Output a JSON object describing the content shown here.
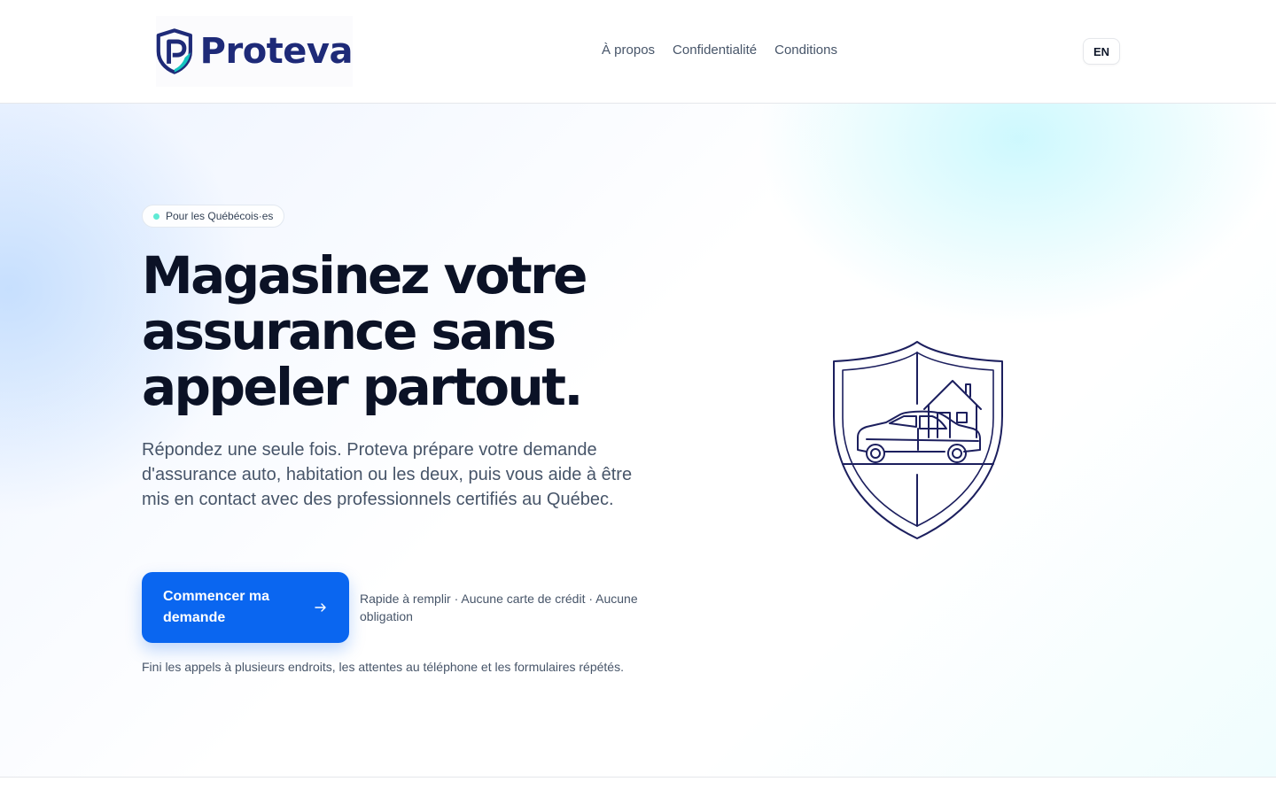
{
  "brand": {
    "name": "Proteva",
    "logo_icon": "shield-p-logo-icon",
    "colors": {
      "navy": "#1e2a78",
      "teal": "#14c5c0",
      "accent": "#0a66f0"
    }
  },
  "nav": {
    "items": [
      {
        "label": "À propos"
      },
      {
        "label": "Confidentialité"
      },
      {
        "label": "Conditions"
      }
    ],
    "lang_toggle": "EN"
  },
  "hero": {
    "badge": "Pour les Québécois·es",
    "title": "Magasinez votre assurance sans appeler partout.",
    "subtitle": "Répondez une seule fois. Proteva prépare votre demande d'assurance auto, habitation ou les deux, puis vous aide à être mis en contact avec des professionnels certifiés au Québec.",
    "cta_label": "Commencer ma demande",
    "cta_icon": "arrow-right-icon",
    "cta_note": "Rapide à remplir · Aucune carte de crédit · Aucune obligation",
    "footnote": "Fini les appels à plusieurs endroits, les attentes au téléphone et les formulaires répétés.",
    "illustration": "shield-car-house-illustration"
  }
}
